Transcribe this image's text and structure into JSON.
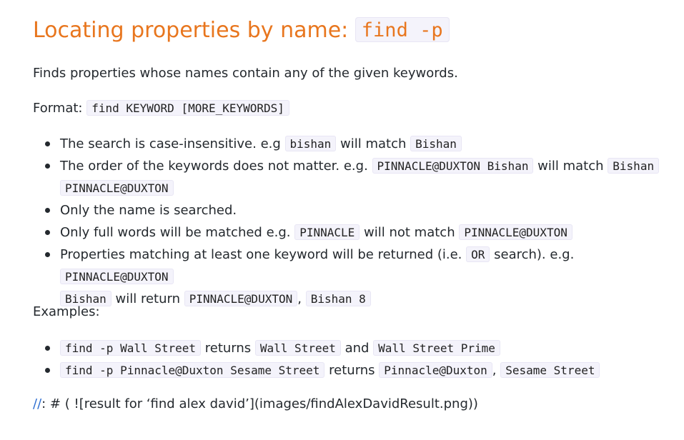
{
  "heading": {
    "text": "Locating properties by name: ",
    "code": "find -p"
  },
  "description": "Finds properties whose names contain any of the given keywords.",
  "format": {
    "label": "Format: ",
    "code": "find KEYWORD [MORE_KEYWORDS]"
  },
  "notes": {
    "n1": {
      "t1": "The search is case-insensitive. e.g ",
      "c1": "bishan",
      "t2": " will match ",
      "c2": "Bishan"
    },
    "n2": {
      "t1": "The order of the keywords does not matter. e.g. ",
      "c1": "PINNACLE@DUXTON Bishan",
      "t2": " will match ",
      "c2a": "Bishan",
      "c2b": "PINNACLE@DUXTON"
    },
    "n3": {
      "t1": "Only the name is searched."
    },
    "n4": {
      "t1": "Only full words will be matched e.g. ",
      "c1": "PINNACLE",
      "t2": " will not match ",
      "c2": "PINNACLE@DUXTON"
    },
    "n5": {
      "t1": "Properties matching at least one keyword will be returned (i.e. ",
      "c1": "OR",
      "t2": " search). e.g. ",
      "c2a": "PINNACLE@DUXTON",
      "c2b": "Bishan",
      "t3": " will return ",
      "c3": "PINNACLE@DUXTON",
      "t4": ", ",
      "c4": "Bishan 8"
    }
  },
  "examples_label": "Examples:",
  "examples": {
    "e1": {
      "c1": "find -p Wall Street",
      "t1": " returns ",
      "c2": "Wall Street",
      "t2": " and ",
      "c3": "Wall Street Prime"
    },
    "e2": {
      "c1": "find -p Pinnacle@Duxton Sesame Street",
      "t1": " returns ",
      "c2": "Pinnacle@Duxton",
      "t2": ", ",
      "c3": "Sesame Street"
    }
  },
  "footer": {
    "slashes": "//",
    "text": ": # ( ![result for ‘find alex david’](images/findAlexDavidResult.png))"
  },
  "colors": {
    "heading": "#e8761e",
    "link": "#2f6fd1",
    "code_background": "#f4f3fb"
  }
}
